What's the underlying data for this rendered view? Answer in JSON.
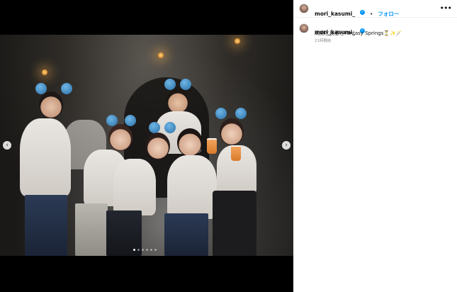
{
  "post": {
    "username": "mori_kasumi_",
    "verified": true,
    "follow_label": "フォロー",
    "separator": "•",
    "more_label": "•••",
    "caption": "同期と後輩とFantasy Springs⏳✨🪄",
    "timestamp": "21時間前"
  },
  "carousel": {
    "prev_label": "‹",
    "next_label": "›",
    "slide_count": 6,
    "active_index": 0
  },
  "colors": {
    "accent": "#0095f6",
    "secondary_text": "#8e8e8e",
    "panel_bg": "#ffffff",
    "media_bg": "#000000"
  },
  "icons": {
    "verified": "verified-badge-icon",
    "more": "more-options-icon",
    "prev": "chevron-left-icon",
    "next": "chevron-right-icon"
  }
}
